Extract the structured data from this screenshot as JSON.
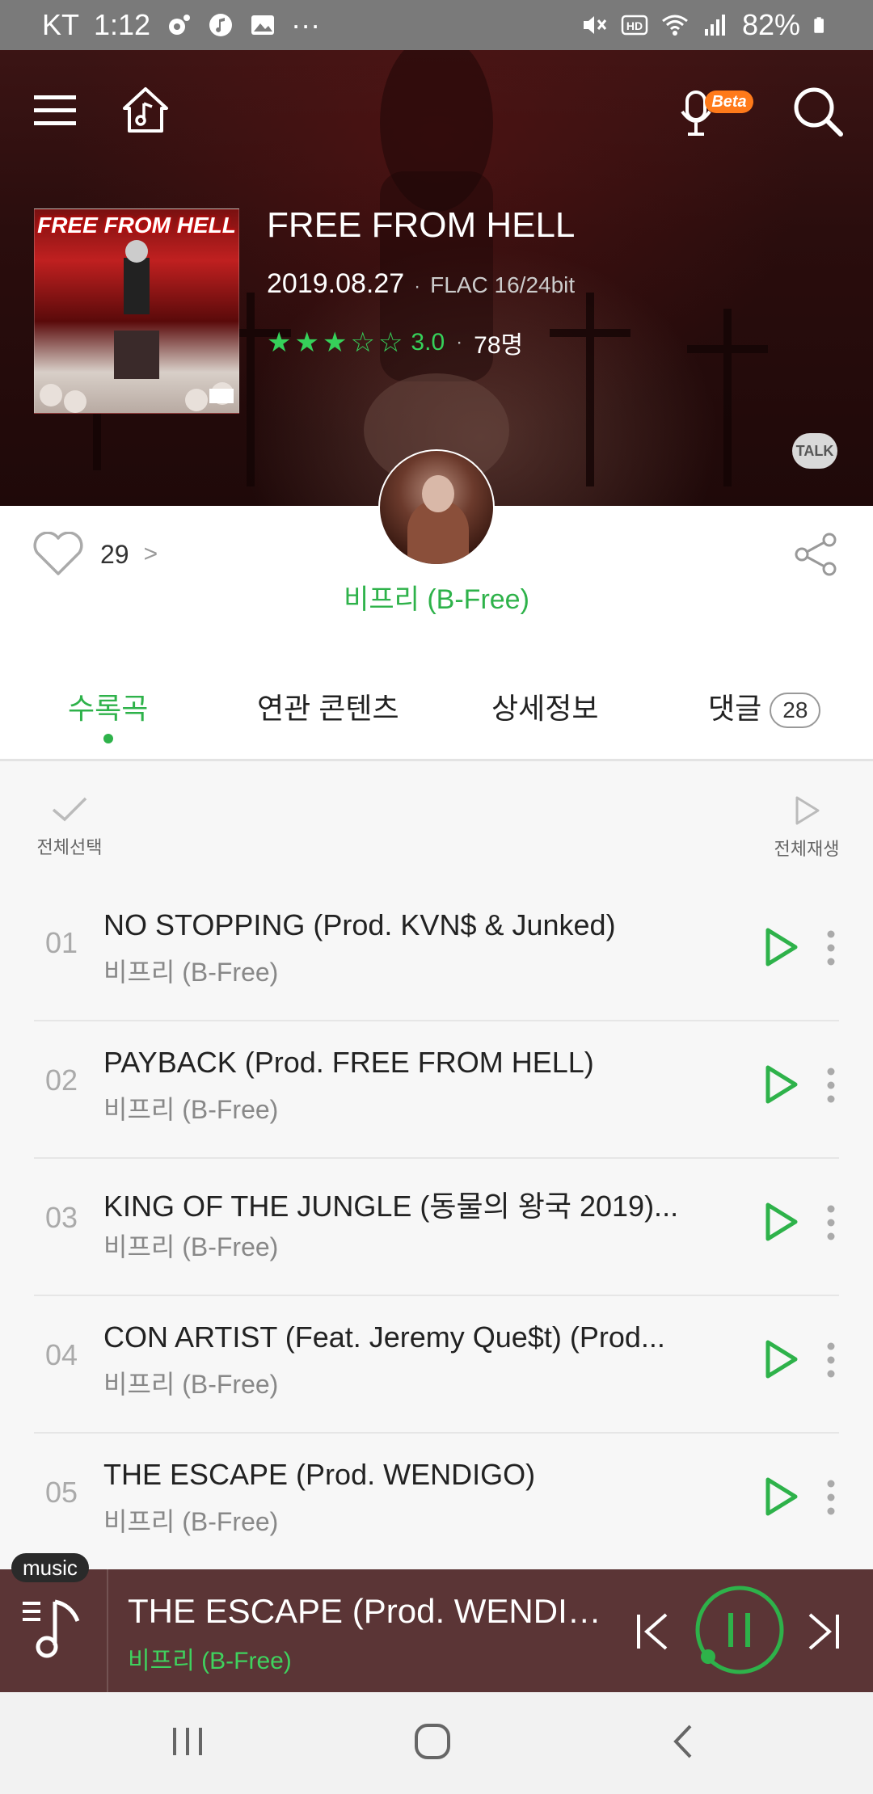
{
  "status_bar": {
    "carrier": "KT",
    "time": "1:12",
    "more_indicator": "···",
    "battery_percent": "82%"
  },
  "header": {
    "menu_icon": "menu-icon",
    "home_icon": "music-home-icon",
    "mic_beta_badge": "Beta",
    "search_icon": "search-icon",
    "cover_text": "FREE FROM HELL",
    "album_title": "FREE FROM HELL",
    "release_date": "2019.08.27",
    "separator": "·",
    "quality": "FLAC 16/24bit",
    "rating": {
      "filled_stars": 3,
      "total_stars": 5,
      "score": "3.0",
      "participants": "78명"
    },
    "talk_label": "TALK"
  },
  "info": {
    "like_count": "29",
    "like_chevron": ">",
    "artist": "비프리 (B-Free)"
  },
  "tabs": [
    {
      "label": "수록곡",
      "active": true
    },
    {
      "label": "연관 콘텐츠",
      "active": false
    },
    {
      "label": "상세정보",
      "active": false
    },
    {
      "label": "댓글",
      "active": false,
      "badge": "28"
    }
  ],
  "list_controls": {
    "select_all": "전체선택",
    "play_all": "전체재생"
  },
  "tracks": [
    {
      "no": "01",
      "title": "NO STOPPING (Prod. KVN$ & Junked)",
      "artist": "비프리 (B-Free)"
    },
    {
      "no": "02",
      "title": "PAYBACK (Prod. FREE FROM HELL)",
      "artist": "비프리 (B-Free)"
    },
    {
      "no": "03",
      "title": "KING OF THE JUNGLE (동물의 왕국 2019)...",
      "artist": "비프리 (B-Free)"
    },
    {
      "no": "04",
      "title": "CON ARTIST (Feat. Jeremy Que$t) (Prod...",
      "artist": "비프리 (B-Free)"
    },
    {
      "no": "05",
      "title": "THE ESCAPE (Prod. WENDIGO)",
      "artist": "비프리 (B-Free)"
    }
  ],
  "player": {
    "tab_label": "music",
    "title": "THE ESCAPE (Prod. WENDIG...",
    "artist": "비프리 (B-Free)",
    "state": "playing"
  },
  "colors": {
    "accent_green": "#2eb24a",
    "header_bg": "#2a0d0d",
    "player_bg": "#5b3536"
  }
}
